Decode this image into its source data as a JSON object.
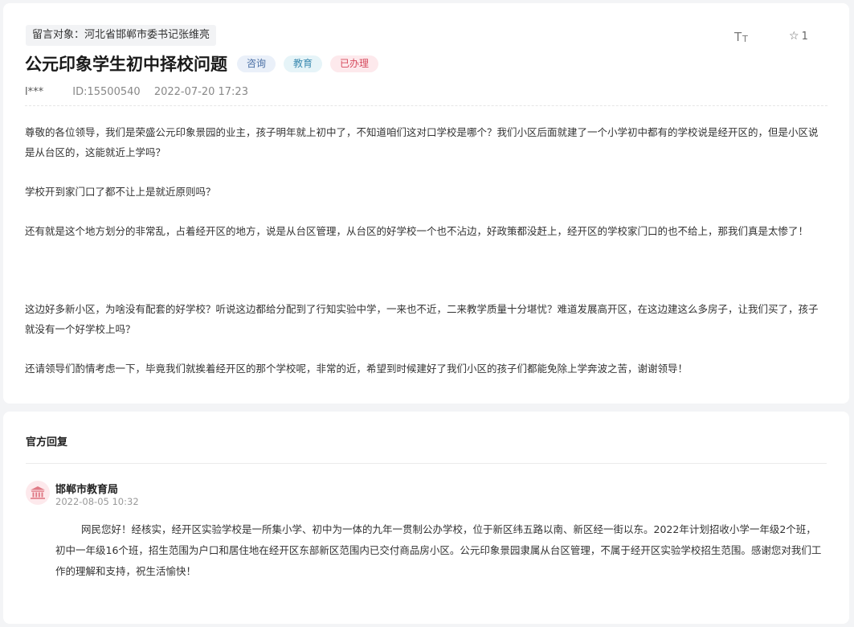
{
  "message": {
    "target": "留言对象：河北省邯郸市委书记张维亮",
    "title": "公元印象学生初中择校问题",
    "tags": [
      "咨询",
      "教育",
      "已办理"
    ],
    "tools": {
      "font_big": "T",
      "font_small": "T",
      "favorite_count": "1"
    },
    "author": "l***",
    "id": "ID:15500540",
    "datetime": "2022-07-20 17:23",
    "paragraphs": [
      [
        "尊敬的各位领导，我们是荣盛公元印象景园的业主，孩子明年就上初中了，不知道咱们这对口学校是哪个？我们小区后面就建了一个小学初中都有的学校说是经开区的，但是小区说",
        "是从台区的，这能就近上学吗？"
      ],
      [
        "学校开到家门口了都不让上是就近原则吗？"
      ],
      [
        "还有就是这个地方划分的非常乱，占着经开区的地方，说是从台区管理，从台区的好学校一个也不沾边，好政策都没赶上，经开区的学校家门口的也不给上，那我们真是太惨了！"
      ],
      [
        "这边好多新小区，为啥没有配套的好学校？听说这边都给分配到了行知实验中学，一来也不近，二来教学质量十分堪忧？难道发展高开区，在这边建这么多房子，让我们买了，孩子",
        "就没有一个好学校上吗？"
      ],
      [
        "还请领导们酌情考虑一下，毕竟我们就挨着经开区的那个学校呢，非常的近，希望到时候建好了我们小区的孩子们都能免除上学奔波之苦，谢谢领导！"
      ]
    ]
  },
  "reply": {
    "section_title": "官方回复",
    "avatar_icon": "government-building-icon",
    "org": "邯郸市教育局",
    "datetime": "2022-08-05 10:32",
    "lines": [
      "网民您好！经核实，经开区实验学校是一所集小学、初中为一体的九年一贯制公办学校，位于新区纬五路以南、新区经一街以东。2022年计划招收小学一年级2个班，",
      "初中一年级16个班，招生范围为户口和居住地在经开区东部新区范围内已交付商品房小区。公元印象景园隶属从台区管理，不属于经开区实验学校招生范围。感谢您对我们工",
      "作的理解和支持，祝生活愉快！"
    ]
  },
  "colors": {
    "tag_blue": "#4a6fa5",
    "tag_cyan": "#3b8ab0",
    "tag_red": "#d64a5d",
    "avatar_icon": "#e07a86"
  }
}
